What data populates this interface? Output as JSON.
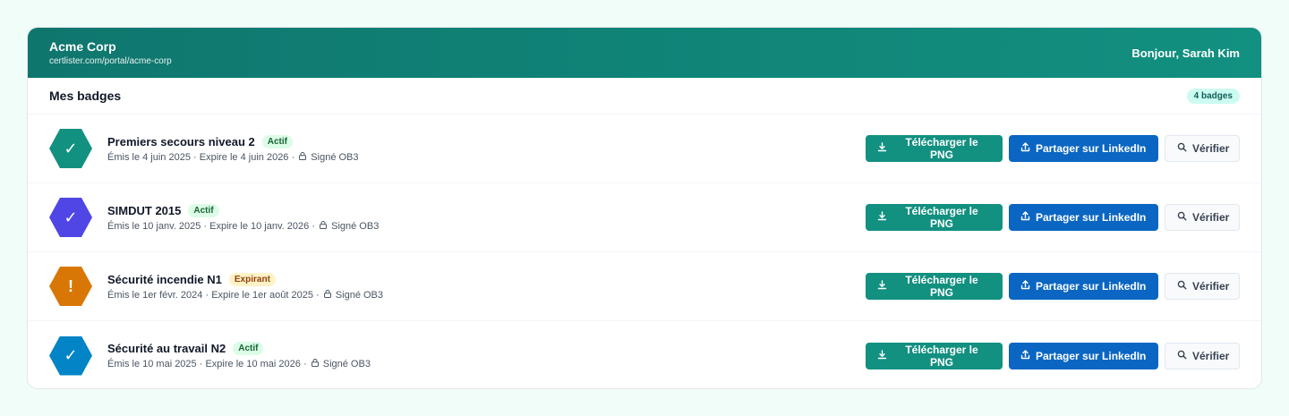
{
  "header": {
    "org_name": "Acme Corp",
    "org_url": "certlister.com/portal/acme-corp",
    "greeting": "Bonjour, Sarah Kim"
  },
  "section": {
    "title": "Mes badges",
    "count_label": "4 badges"
  },
  "actions": {
    "download_label": "Télécharger le PNG",
    "share_label": "Partager sur LinkedIn",
    "verify_label": "Vérifier"
  },
  "badges": [
    {
      "title": "Premiers secours niveau 2",
      "status": "Actif",
      "issued": "Émis le 4 juin 2025",
      "expires": "Expire le 4 juin 2026",
      "signed": "Signé OB3",
      "icon": "✓",
      "icon_name": "check-icon",
      "color": "#129080"
    },
    {
      "title": "SIMDUT 2015",
      "status": "Actif",
      "issued": "Émis le 10 janv. 2025",
      "expires": "Expire le 10 janv. 2026",
      "signed": "Signé OB3",
      "icon": "✓",
      "icon_name": "check-icon",
      "color": "#4f46e5"
    },
    {
      "title": "Sécurité incendie N1",
      "status": "Expirant",
      "issued": "Émis le 1er févr. 2024",
      "expires": "Expire le 1er août 2025",
      "signed": "Signé OB3",
      "icon": "!",
      "icon_name": "warning-icon",
      "color": "#d97706"
    },
    {
      "title": "Sécurité au travail N2",
      "status": "Actif",
      "issued": "Émis le 10 mai 2025",
      "expires": "Expire le 10 mai 2026",
      "signed": "Signé OB3",
      "icon": "✓",
      "icon_name": "check-icon",
      "color": "#0284c7"
    }
  ],
  "colors": {
    "header_start": "#0f766e",
    "header_end": "#129080",
    "download_button": "#129080",
    "linkedin_button": "#0a66c2",
    "status_active_bg": "#dcfce7",
    "status_expiring_bg": "#fef3c7"
  }
}
